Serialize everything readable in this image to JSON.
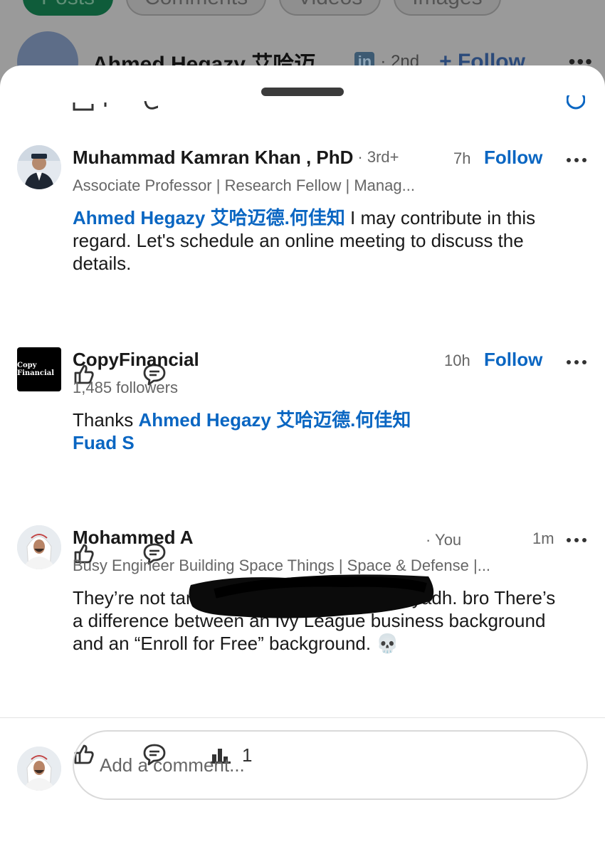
{
  "background": {
    "tabs": [
      "Posts",
      "Comments",
      "Videos",
      "Images"
    ],
    "author_name": "Ahmed Hegazy 艾哈迈...",
    "linkedin_badge": "in",
    "degree": "· 2nd",
    "follow_label": "+ Follow"
  },
  "comments": [
    {
      "name": "Muhammad Kamran Khan , PhD",
      "degree": "· 3rd+",
      "time": "7h",
      "follow_label": "Follow",
      "headline": "Associate Professor | Research Fellow | Manag...",
      "mention": "Ahmed Hegazy 艾哈迈德.何佳知",
      "text": " I may contribute in this regard. Let's schedule an online meeting to discuss the details."
    },
    {
      "name": "CopyFinancial",
      "logo_text": "Copy Financial",
      "time": "10h",
      "follow_label": "Follow",
      "headline": "1,485 followers",
      "text": "Thanks ",
      "mention": "Ahmed Hegazy 艾哈迈德.何佳知",
      "mention2": "Fuad S"
    },
    {
      "name": "Mohammed A",
      "degree": "· You",
      "time": "1m",
      "headline": "Busy Engineer Building Space Things | Space & Defense |...",
      "text": "They’re not targeting you to relocate to Riyadh. bro There’s a difference between an Ivy League business background and an “Enroll for Free” background. 💀",
      "stats_count": "1"
    }
  ],
  "composer": {
    "placeholder": "Add a comment..."
  },
  "colors": {
    "link": "#0a66c2",
    "text": "#191919",
    "muted": "#666666"
  },
  "icons": [
    "like-icon",
    "comment-icon",
    "stats-icon",
    "more-icon",
    "skull-emoji"
  ]
}
